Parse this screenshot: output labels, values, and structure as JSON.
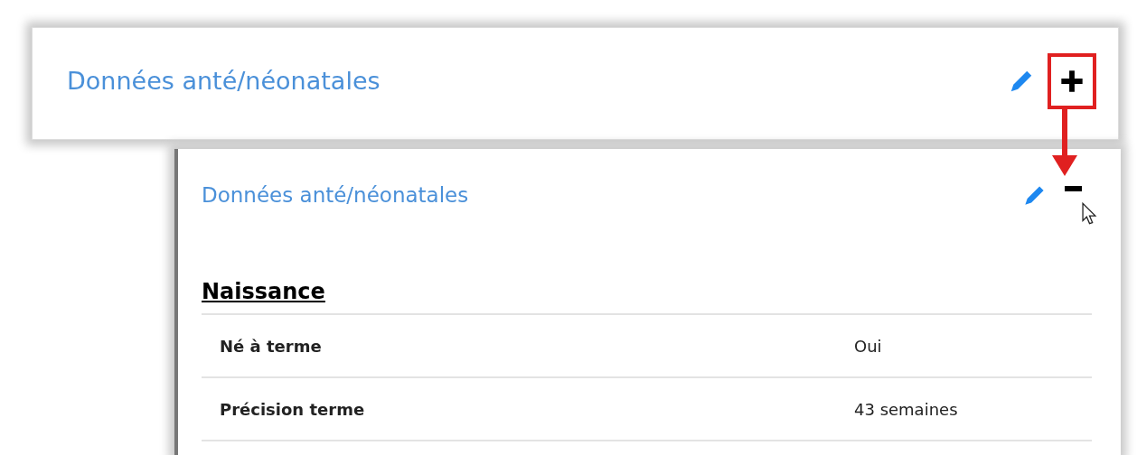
{
  "panels": [
    {
      "title": "Données anté/néonatales",
      "expanded": false,
      "highlighted": true
    },
    {
      "title": "Données anté/néonatales",
      "expanded": true,
      "highlighted": false,
      "section": {
        "heading": "Naissance",
        "rows": [
          {
            "label": "Né à terme",
            "value": "Oui"
          },
          {
            "label": "Précision terme",
            "value": "43 semaines"
          }
        ]
      }
    }
  ]
}
